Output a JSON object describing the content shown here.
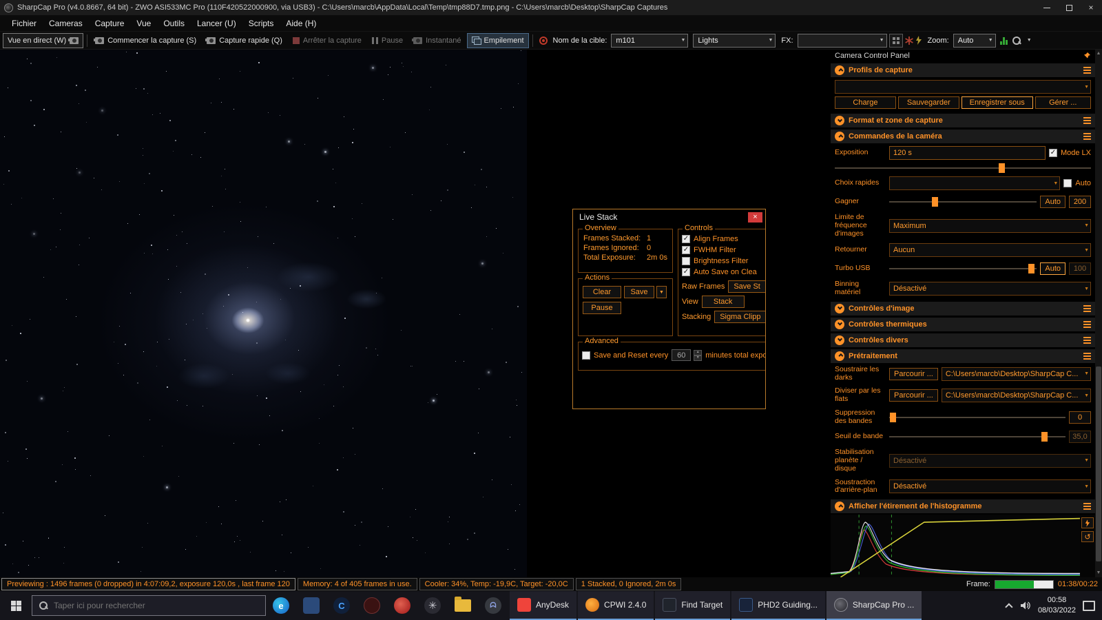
{
  "window": {
    "title": "SharpCap Pro (v4.0.8667, 64 bit) - ZWO ASI533MC Pro (110F420522000900, via USB3) - C:\\Users\\marcb\\AppData\\Local\\Temp\\tmp88D7.tmp.png - C:\\Users\\marcb\\Desktop\\SharpCap Captures"
  },
  "menu": {
    "items": [
      "Fichier",
      "Cameras",
      "Capture",
      "Vue",
      "Outils",
      "Lancer (U)",
      "Scripts",
      "Aide (H)"
    ]
  },
  "toolbar": {
    "live_view": "Vue en direct (W)",
    "start_capture": "Commencer la capture (S)",
    "quick_capture": "Capture rapide (Q)",
    "stop_capture": "Arrêter la capture",
    "pause": "Pause",
    "snapshot": "Instantané",
    "stacking": "Empilement",
    "target_label": "Nom de la cible:",
    "target_value": "m101",
    "frame_type": "Lights",
    "fx_label": "FX:",
    "zoom_label": "Zoom:",
    "zoom_value": "Auto"
  },
  "livestack": {
    "title": "Live Stack",
    "overview_title": "Overview",
    "frames_stacked_label": "Frames Stacked:",
    "frames_stacked": "1",
    "frames_ignored_label": "Frames Ignored:",
    "frames_ignored": "0",
    "total_exposure_label": "Total Exposure:",
    "total_exposure": "2m 0s",
    "controls_title": "Controls",
    "align_frames": "Align Frames",
    "fwhm_filter": "FWHM Filter",
    "brightness_filter": "Brightness Filter",
    "auto_save": "Auto Save on Clea",
    "raw_frames_label": "Raw Frames",
    "raw_frames_button": "Save St",
    "view_label": "View",
    "view_button": "Stack",
    "stacking_label": "Stacking",
    "stacking_button": "Sigma Clipp",
    "actions_title": "Actions",
    "clear": "Clear",
    "save": "Save",
    "pause": "Pause",
    "advanced_title": "Advanced",
    "save_reset": "Save and Reset every",
    "minutes": "60",
    "minutes_suffix": "minutes total exposu"
  },
  "panel": {
    "title": "Camera Control Panel",
    "profiles_header": "Profils de capture",
    "profiles_buttons": [
      "Charge",
      "Sauvegarder",
      "Enregistrer sous",
      "Gérer ..."
    ],
    "format_header": "Format et zone de capture",
    "camera_header": "Commandes de la caméra",
    "exposure_label": "Exposition",
    "exposure_value": "120 s",
    "lx_mode_label": "Mode LX",
    "quick_picks_label": "Choix rapides",
    "quick_auto_label": "Auto",
    "gain_label": "Gagner",
    "gain_auto": "Auto",
    "gain_value": "200",
    "fps_label": "Limite de fréquence d'images",
    "fps_value": "Maximum",
    "flip_label": "Retourner",
    "flip_value": "Aucun",
    "usb_label": "Turbo USB",
    "usb_auto": "Auto",
    "usb_value": "100",
    "binning_label": "Binning matériel",
    "binning_value": "Désactivé",
    "image_header": "Contrôles d'image",
    "thermal_header": "Contrôles thermiques",
    "misc_header": "Contrôles divers",
    "preproc_header": "Prétraitement",
    "darks_label": "Soustraire les darks",
    "browse_label": "Parcourir ...",
    "darks_path": "C:\\Users\\marcb\\Desktop\\SharpCap C...",
    "flats_label": "Diviser par les flats",
    "flats_path": "C:\\Users\\marcb\\Desktop\\SharpCap C...",
    "banding_label": "Suppression des bandes",
    "banding_value": "0",
    "threshold_label": "Seuil de bande",
    "threshold_value": "35,0",
    "stab_label": "Stabilisation planète / disque",
    "stab_value": "Désactivé",
    "bg_label": "Soustraction d'arrière-plan",
    "bg_value": "Désactivé",
    "histogram_header": "Afficher l'étirement de l'histogramme"
  },
  "statusbar": {
    "previewing": "Previewing : 1496 frames (0 dropped) in 4:07:09,2, exposure 120,0s , last frame 120",
    "memory": "Memory: 4 of 405 frames in use.",
    "cooler": "Cooler: 34%, Temp: -19,9C, Target: -20,0C",
    "stacked": "1 Stacked, 0 Ignored, 2m 0s",
    "frame_label": "Frame:",
    "frame_time": "01:38/00:22"
  },
  "taskbar": {
    "search_placeholder": "Taper ici pour rechercher",
    "apps": [
      "AnyDesk",
      "CPWI 2.4.0",
      "Find Target",
      "PHD2 Guiding...",
      "SharpCap Pro ..."
    ],
    "time": "00:58",
    "date": "08/03/2022"
  },
  "icons": {
    "close": "×",
    "dropdown": "▼",
    "check": "✓",
    "undo": "↺",
    "spin_up": "▲",
    "spin_down": "▼"
  }
}
